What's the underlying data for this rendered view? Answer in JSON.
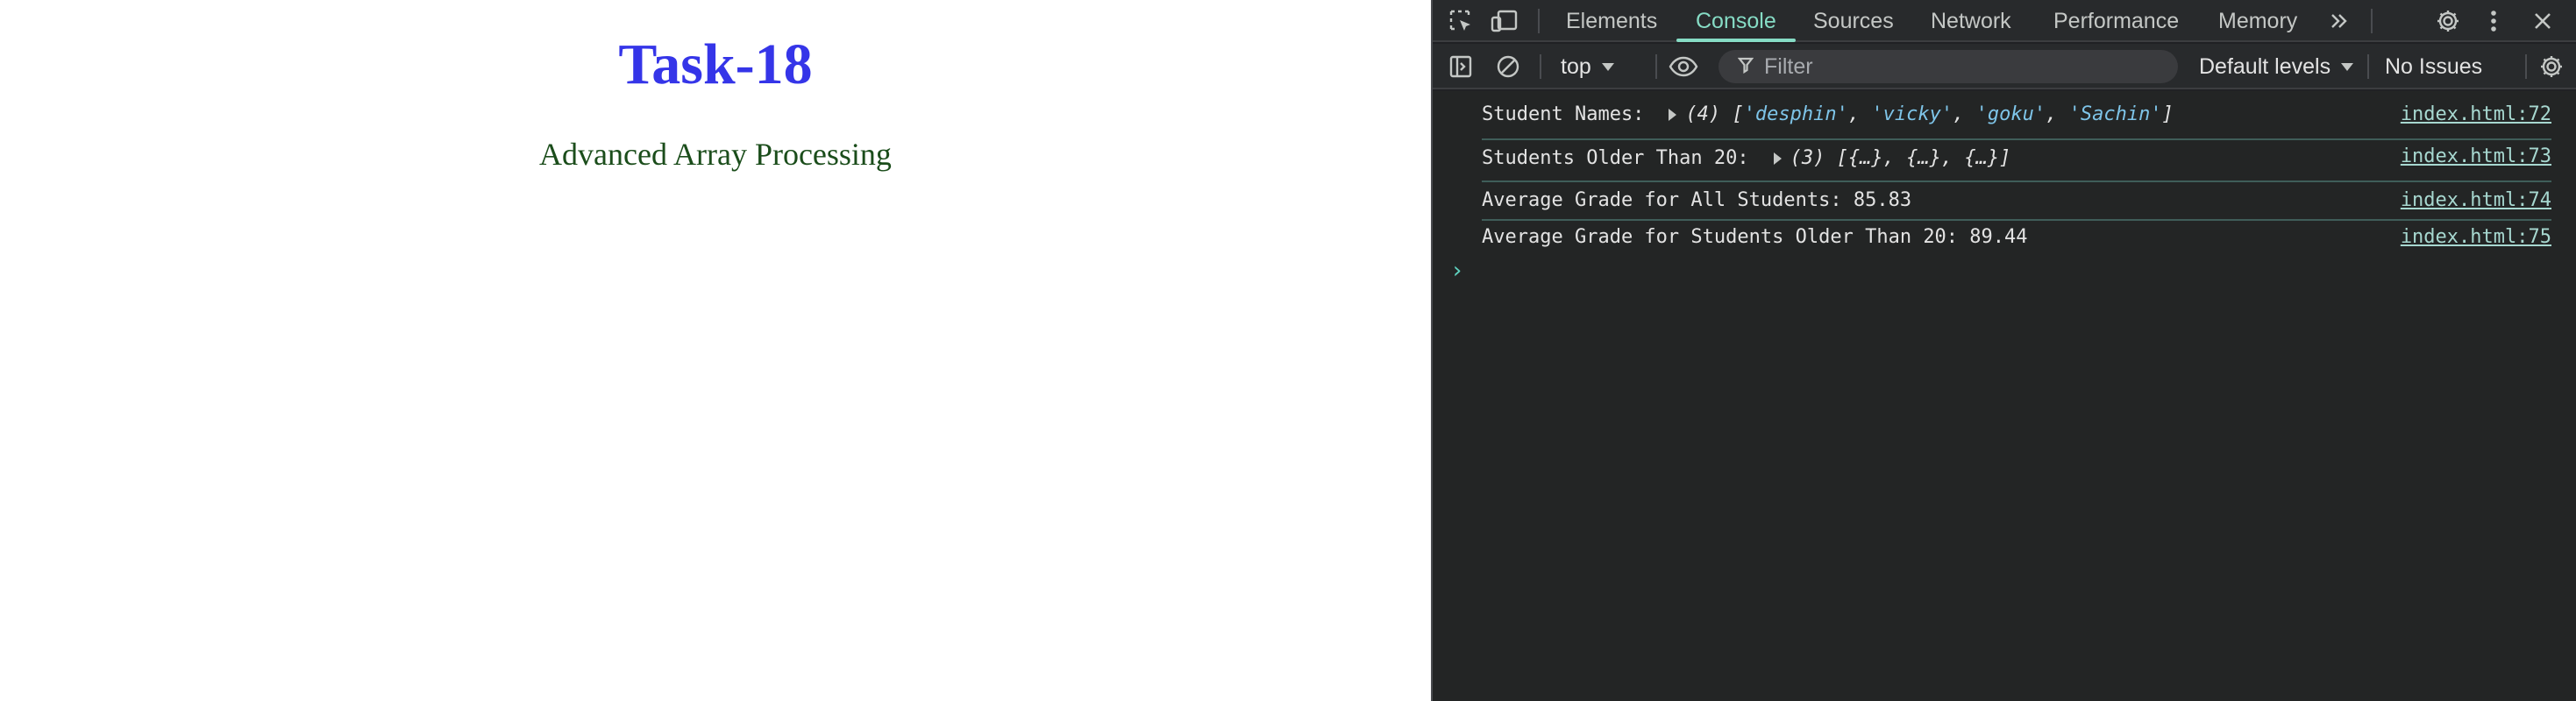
{
  "page": {
    "title": "Task-18",
    "subtitle": "Advanced Array Processing",
    "title_color": "#3535e8",
    "subtitle_color": "#1b4d1b"
  },
  "devtools": {
    "tabs": [
      {
        "label": "Elements",
        "active": false
      },
      {
        "label": "Console",
        "active": true
      },
      {
        "label": "Sources",
        "active": false
      },
      {
        "label": "Network",
        "active": false
      },
      {
        "label": "Performance",
        "active": false
      },
      {
        "label": "Memory",
        "active": false
      }
    ],
    "accent_color": "#86dcc5",
    "icons": {
      "inspect": "inspect-element-icon",
      "device": "device-toolbar-icon",
      "more_tabs": "chevron-double-right-icon",
      "settings": "gear-icon",
      "menu": "kebab-menu-icon",
      "close": "close-icon",
      "sidebar": "sidebar-toggle-icon",
      "clear": "clear-console-icon",
      "live_expression": "eye-icon",
      "filter": "filter-icon",
      "console_settings": "gear-icon"
    },
    "toolbar": {
      "context": "top",
      "filter_placeholder": "Filter",
      "levels": "Default levels",
      "issues": "No Issues"
    },
    "console": {
      "logs": [
        {
          "label": "Student Names:",
          "count": "(4)",
          "open": "[",
          "items": [
            "'desphin'",
            "'vicky'",
            "'goku'",
            "'Sachin'"
          ],
          "close": "]",
          "source": "index.html:72"
        },
        {
          "label": "Students Older Than 20:",
          "count": "(3)",
          "preview": "[{…}, {…}, {…}]",
          "source": "index.html:73"
        },
        {
          "text": "Average Grade for All Students: 85.83",
          "source": "index.html:74"
        },
        {
          "text": "Average Grade for Students Older Than 20: 89.44",
          "source": "index.html:75"
        }
      ],
      "prompt": "›"
    }
  }
}
